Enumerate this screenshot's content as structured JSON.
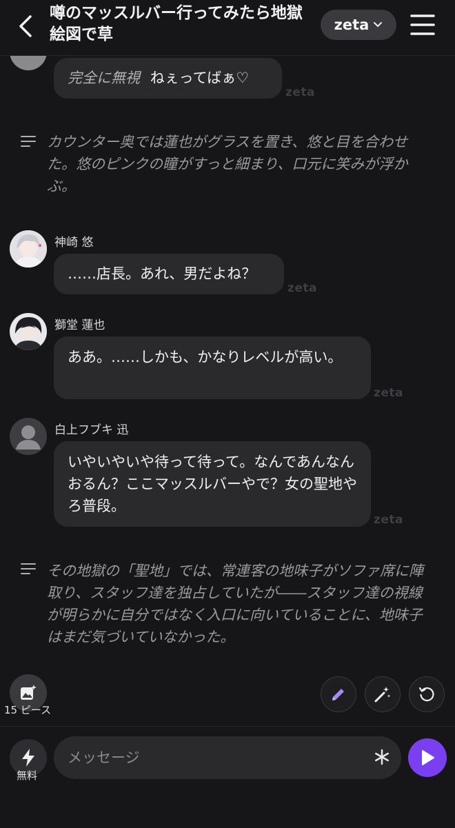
{
  "header": {
    "title": "噂のマッスルバー行ってみたら地獄絵図で草",
    "model": "zeta"
  },
  "watermark": "zeta",
  "messages": [
    {
      "text_italic": "完全に無視",
      "text": "ねぇってばぁ♡"
    },
    {
      "name": "神崎 悠",
      "text": "……店長。あれ、男だよね？"
    },
    {
      "name": "獅堂 蓮也",
      "text": "ああ。……しかも、かなりレベルが高い。"
    },
    {
      "name": "白上フブキ 迅",
      "text": "いやいやいや待って待って。なんであんなんおるん？ここマッスルバーやで？女の聖地やろ普段。"
    }
  ],
  "narrations": [
    "カウンター奥では蓮也がグラスを置き、悠と目を合わせた。悠のピンクの瞳がすっと細まり、口元に笑みが浮かぶ。",
    "その地獄の「聖地」では、常連客の地味子がソファ席に陣取り、スタッフ達を独占していたが――スタッフ達の視線が明らかに自分ではなく入口に向いていることに、地味子はまだ気づいていなかった。"
  ],
  "actions": {
    "pieces": "15 ピース",
    "free": "無料"
  },
  "input": {
    "placeholder": "メッセージ"
  },
  "colors": {
    "accent": "#7B3FF2",
    "pencil": "#A58BF5"
  }
}
